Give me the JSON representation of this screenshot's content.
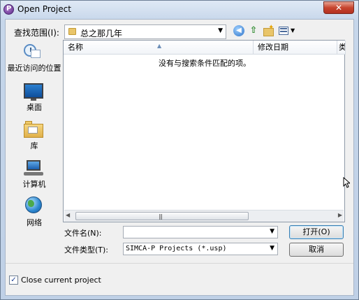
{
  "window": {
    "title": "Open Project",
    "close_label": "✕"
  },
  "toolbar": {
    "lookin_label": "查找范围(I):",
    "lookin_value": "总之那几年",
    "dropdown_arrow": "▼",
    "back_glyph": "◀",
    "up_glyph": "⇧"
  },
  "places": [
    {
      "label": "最近访问的位置",
      "icon": "recent-places-icon"
    },
    {
      "label": "桌面",
      "icon": "desktop-icon"
    },
    {
      "label": "库",
      "icon": "library-icon"
    },
    {
      "label": "计算机",
      "icon": "computer-icon"
    },
    {
      "label": "网络",
      "icon": "network-icon"
    }
  ],
  "filelist": {
    "columns": [
      "名称",
      "修改日期",
      "类"
    ],
    "sort_glyph": "▲",
    "empty_message": "没有与搜索条件匹配的项。",
    "scroll_left": "◀",
    "scroll_right": "▶",
    "scroll_grip": "|||"
  },
  "fields": {
    "filename_label": "文件名(N):",
    "filename_value": "",
    "filetype_label": "文件类型(T):",
    "filetype_value": "SIMCA-P Projects (*.usp)"
  },
  "buttons": {
    "open": "打开(O)",
    "cancel": "取消"
  },
  "close_current": {
    "label": "Close current project",
    "checked": true,
    "mark": "✓"
  }
}
